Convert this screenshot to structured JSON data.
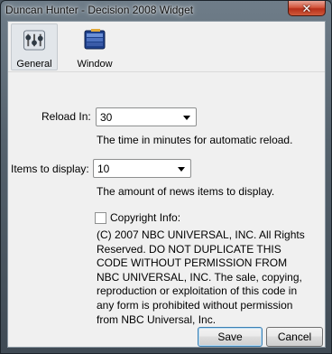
{
  "window": {
    "title": "Duncan Hunter - Decision 2008 Widget",
    "close_glyph": "✕"
  },
  "tabs": [
    {
      "label": "General",
      "icon": "settings-sliders-icon",
      "selected": true
    },
    {
      "label": "Window",
      "icon": "window-stack-icon",
      "selected": false
    }
  ],
  "reload": {
    "label": "Reload In:",
    "value": "30",
    "hint": "The time in minutes for automatic reload."
  },
  "items": {
    "label": "Items to display:",
    "value": "10",
    "hint": "The amount of news items to display."
  },
  "copyright": {
    "label": "Copyright Info:",
    "checked": false,
    "text": "(C) 2007 NBC UNIVERSAL, INC.  All Rights Reserved. DO NOT DUPLICATE THIS CODE WITHOUT PERMISSION FROM NBC UNIVERSAL, INC. The sale, copying, reproduction or exploitation of this code in any form is prohibited without permission from NBC Universal, Inc."
  },
  "buttons": {
    "save": "Save",
    "cancel": "Cancel"
  },
  "colors": {
    "close": "#c7452b",
    "focus_border": "#3c7fb1"
  }
}
